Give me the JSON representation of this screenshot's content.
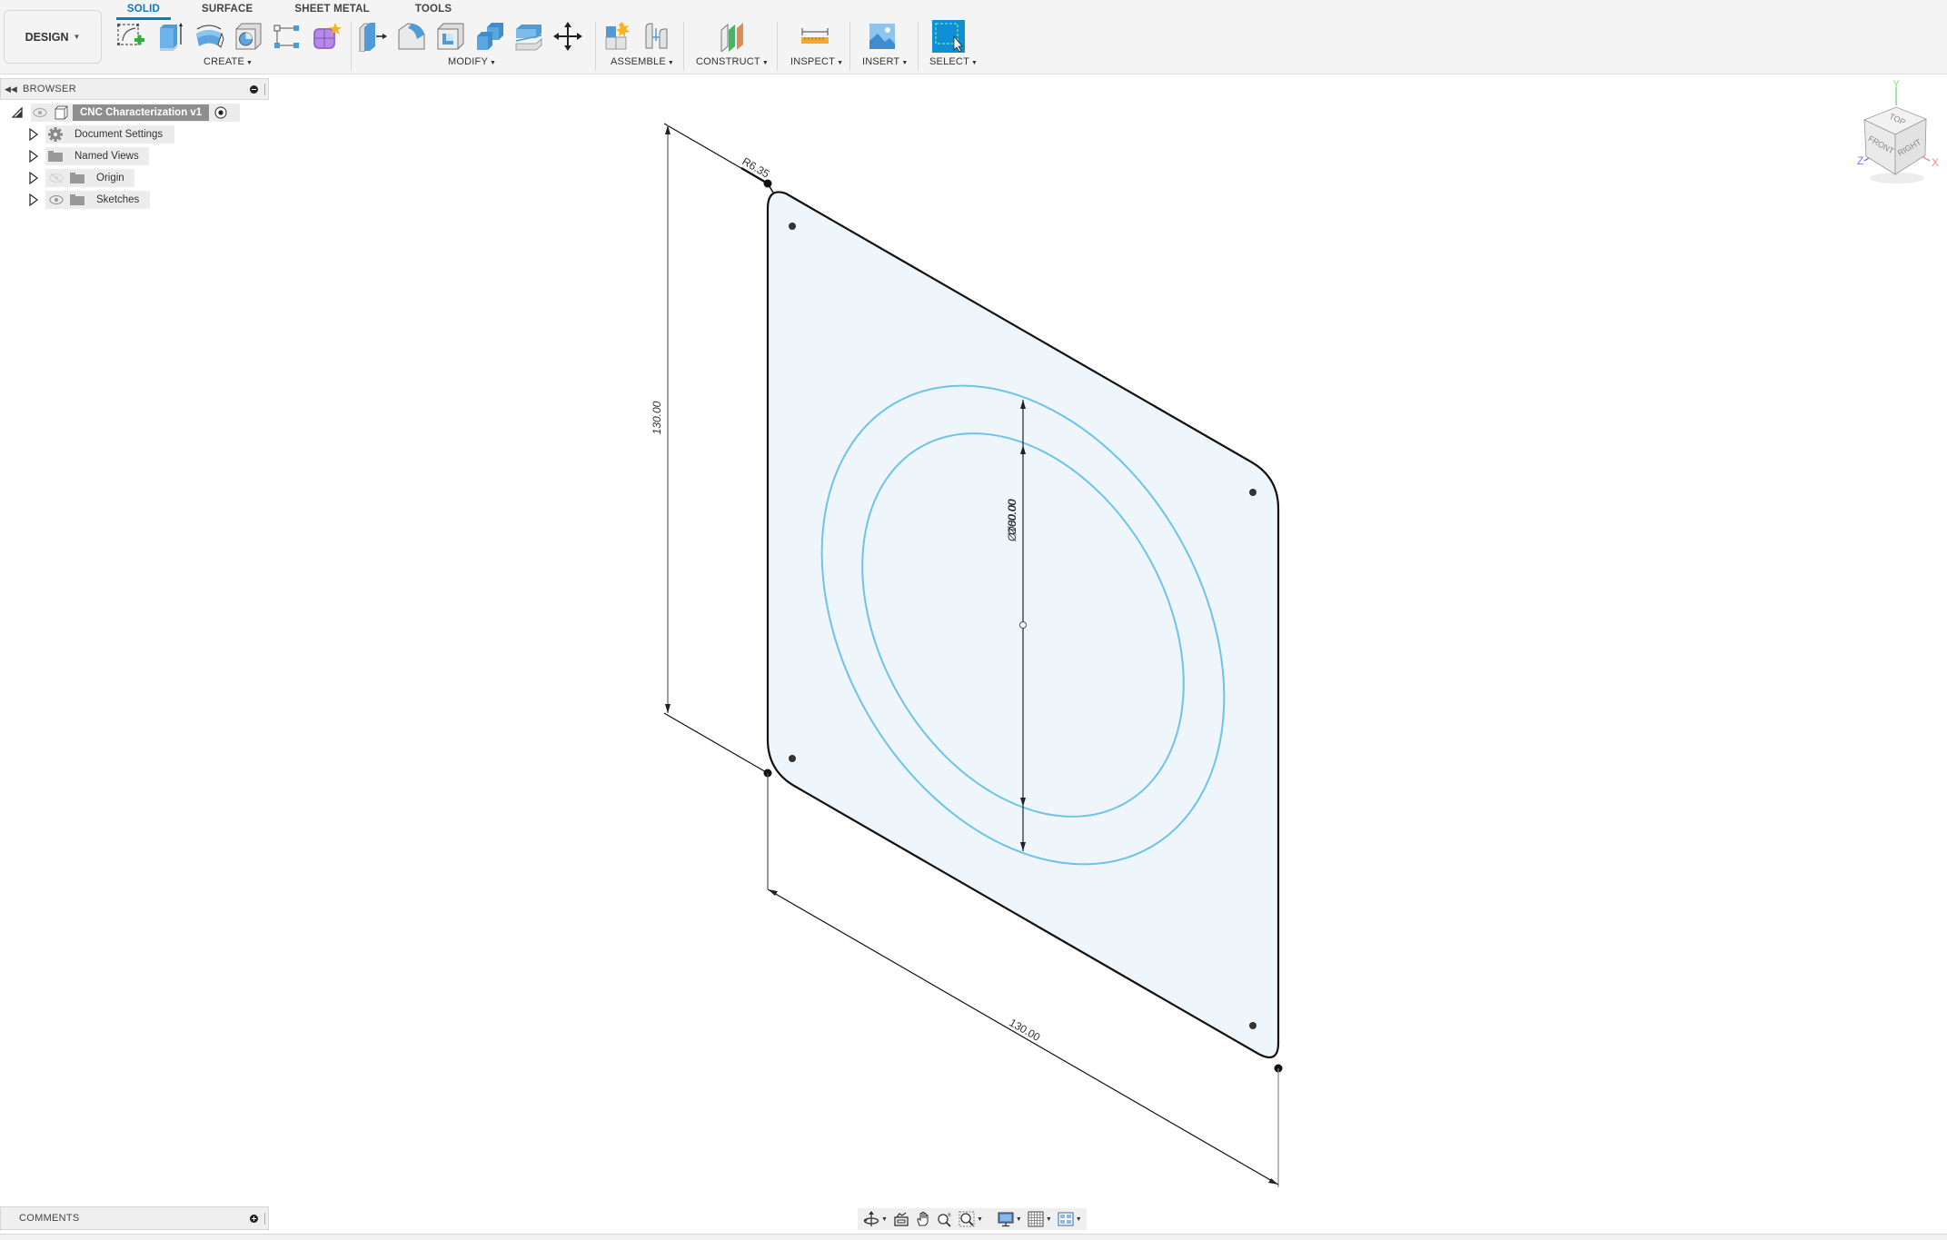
{
  "workspace": {
    "label": "DESIGN"
  },
  "tabs": [
    {
      "label": "SOLID",
      "active": true
    },
    {
      "label": "SURFACE",
      "active": false
    },
    {
      "label": "SHEET METAL",
      "active": false
    },
    {
      "label": "TOOLS",
      "active": false
    }
  ],
  "toolbar_groups": {
    "create": {
      "label": "CREATE",
      "tools": [
        "create-sketch",
        "extrude",
        "revolve",
        "hole",
        "rectangular-pattern",
        "create-form"
      ]
    },
    "modify": {
      "label": "MODIFY",
      "tools": [
        "press-pull",
        "fillet",
        "shell",
        "combine",
        "offset-face",
        "move-copy"
      ]
    },
    "assemble": {
      "label": "ASSEMBLE",
      "tools": [
        "new-component",
        "joint"
      ]
    },
    "construct": {
      "label": "CONSTRUCT",
      "tools": [
        "offset-plane"
      ]
    },
    "inspect": {
      "label": "INSPECT",
      "tools": [
        "measure"
      ]
    },
    "insert": {
      "label": "INSERT",
      "tools": [
        "insert-canvas"
      ]
    },
    "select": {
      "label": "SELECT",
      "tools": [
        "window-select"
      ]
    }
  },
  "browser": {
    "title": "BROWSER",
    "root": {
      "label": "CNC Characterization v1"
    },
    "items": [
      {
        "label": "Document Settings",
        "icon": "gear-icon",
        "visibility": "none"
      },
      {
        "label": "Named Views",
        "icon": "folder-icon",
        "visibility": "none"
      },
      {
        "label": "Origin",
        "icon": "folder-icon",
        "visibility": "hidden"
      },
      {
        "label": "Sketches",
        "icon": "folder-icon",
        "visibility": "visible"
      }
    ]
  },
  "comments": {
    "title": "COMMENTS"
  },
  "viewcube": {
    "top": "TOP",
    "front": "FRONT",
    "right": "RIGHT",
    "axes": {
      "x": "X",
      "y": "Y",
      "z": "Z"
    }
  },
  "sketch": {
    "dimensions": {
      "fillet_radius": "R6.35",
      "height": "130.00",
      "width": "130.00",
      "outer_diameter": "Ø100.00",
      "inner_diameter": "Ø80.00"
    },
    "colors": {
      "plate_fill": "#eef6fc",
      "profile_line": "#6ec3e8",
      "edge": "#111111"
    }
  },
  "navbar": {
    "tools": [
      "orbit",
      "look-at",
      "pan",
      "zoom",
      "fit",
      "display-settings",
      "grid-snaps",
      "viewports"
    ]
  },
  "colors": {
    "accent": "#0b7bc2",
    "select_active": "#0f8fd6"
  }
}
